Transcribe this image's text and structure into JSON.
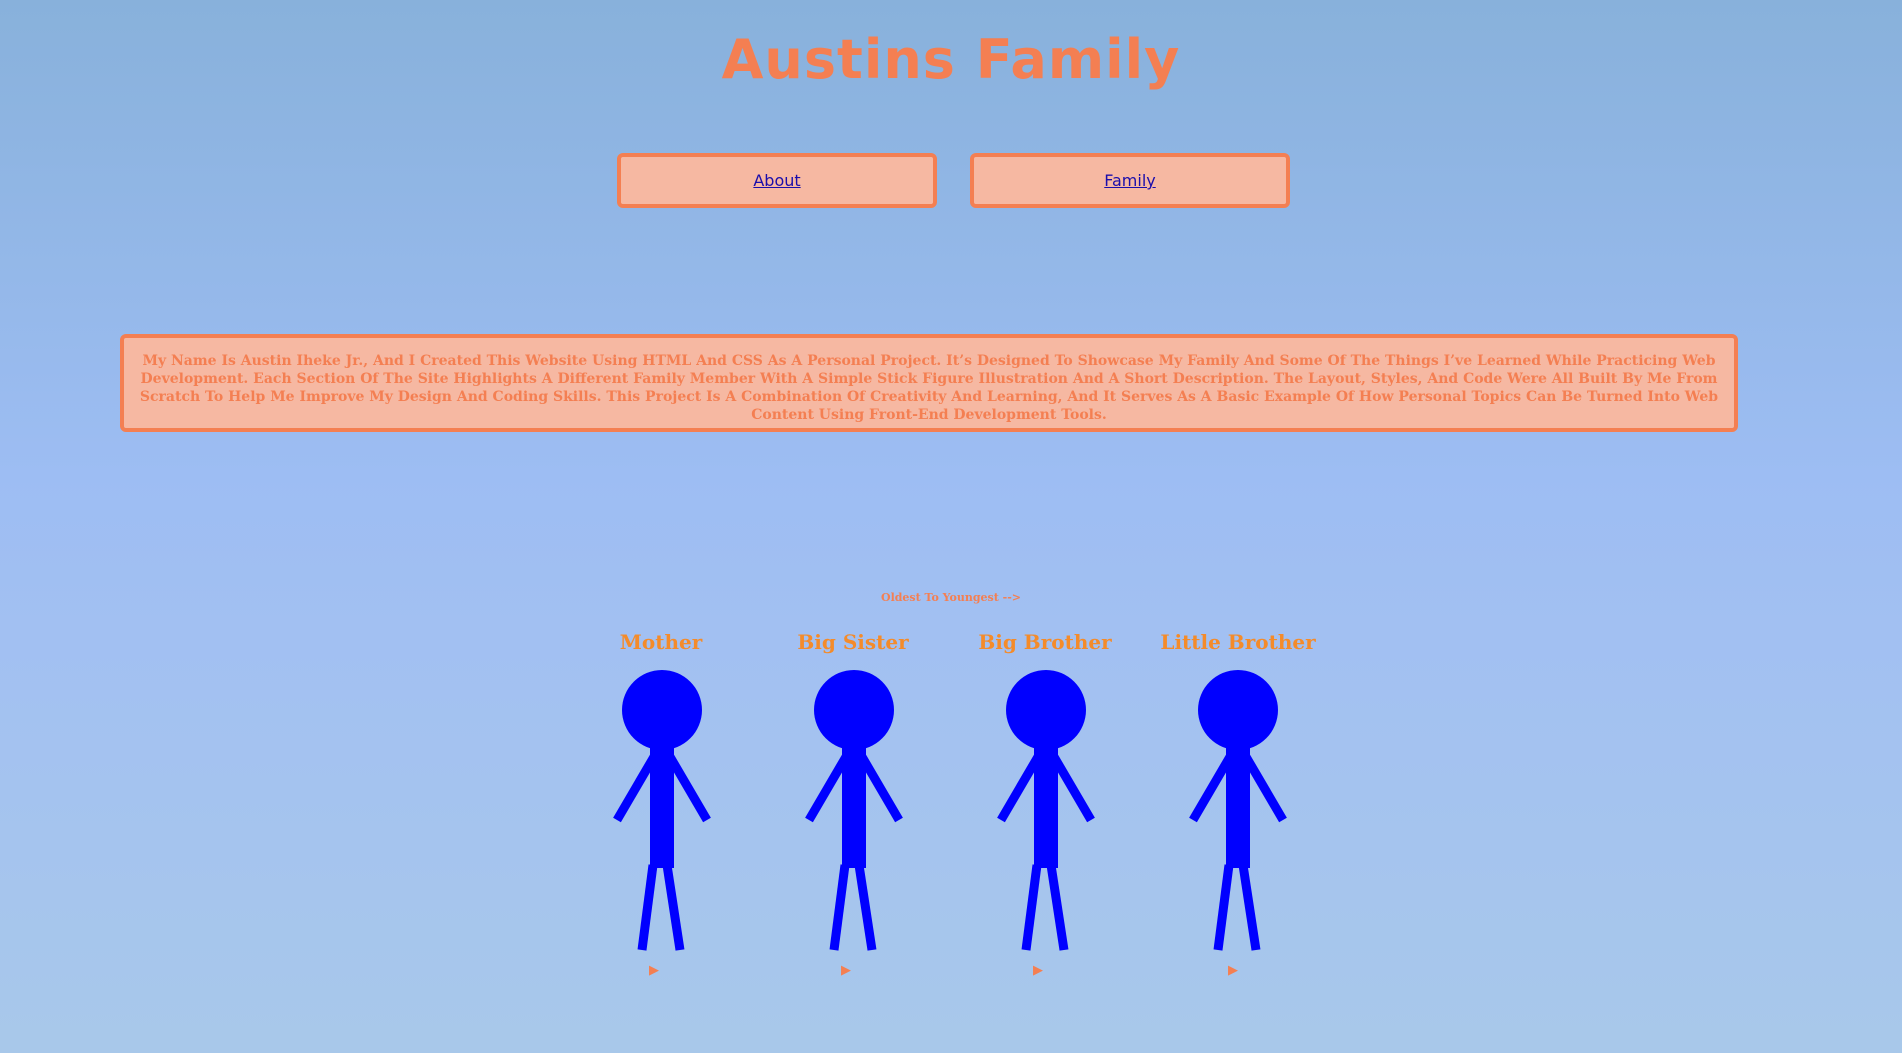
{
  "header": {
    "title": "Austins Family"
  },
  "nav": {
    "about_label": "About",
    "family_label": "Family"
  },
  "about": {
    "text": "My Name Is Austin Iheke Jr., And I Created This Website Using HTML And CSS As A Personal Project. It’s Designed To Showcase My Family And Some Of The Things I’ve Learned While Practicing Web Development. Each Section Of The Site Highlights A Different Family Member With A Simple Stick Figure Illustration And A Short Description. The Layout, Styles, And Code Were All Built By Me From Scratch To Help Me Improve My Design And Coding Skills. This Project Is A Combination Of Creativity And Learning, And It Serves As A Basic Example Of How Personal Topics Can Be Turned Into Web Content Using Front-End Development Tools."
  },
  "family": {
    "order_hint": "Oldest To Youngest -->",
    "members": [
      {
        "name": "Mother",
        "toggle": "▶"
      },
      {
        "name": "Big Sister",
        "toggle": "▶"
      },
      {
        "name": "Big Brother",
        "toggle": "▶"
      },
      {
        "name": "Little Brother",
        "toggle": "▶"
      }
    ]
  },
  "colors": {
    "accent": "#f47f52",
    "panel": "#f6b8a2",
    "name": "#f48b2a",
    "figure": "#0000ff",
    "link": "#1a0dab"
  }
}
